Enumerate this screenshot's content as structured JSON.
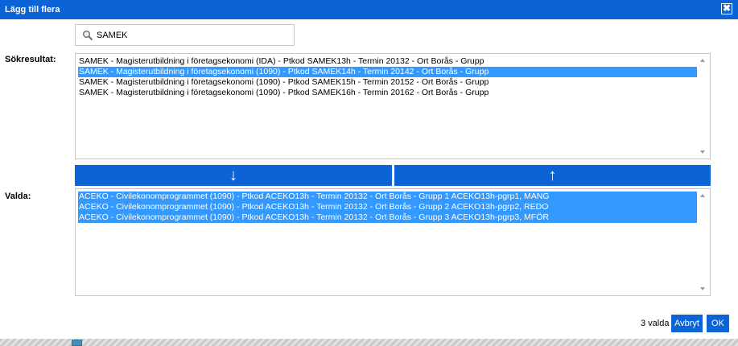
{
  "dialog": {
    "title": "Lägg till flera",
    "close_glyph": "✖"
  },
  "search": {
    "value": "SAMEK",
    "icon": "magnifier-icon"
  },
  "results": {
    "label": "Sökresultat:",
    "items": [
      {
        "text": "SAMEK - Magisterutbildning i företagsekonomi (IDA) - Ptkod SAMEK13h - Termin 20132 - Ort Borås - Grupp",
        "selected": false
      },
      {
        "text": "SAMEK - Magisterutbildning i företagsekonomi (1090) - Ptkod SAMEK14h - Termin 20142 - Ort Borås - Grupp",
        "selected": true
      },
      {
        "text": "SAMEK - Magisterutbildning i företagsekonomi (1090) - Ptkod SAMEK15h - Termin 20152 - Ort Borås - Grupp",
        "selected": false
      },
      {
        "text": "SAMEK - Magisterutbildning i företagsekonomi (1090) - Ptkod SAMEK16h - Termin 20162 - Ort Borås - Grupp",
        "selected": false
      }
    ]
  },
  "move": {
    "down_glyph": "↓",
    "up_glyph": "↑"
  },
  "selected": {
    "label": "Valda:",
    "items": [
      {
        "text": "ACEKO - Civilekonomprogrammet (1090) - Ptkod ACEKO13h - Termin 20132 - Ort Borås - Grupp 1 ACEKO13h-pgrp1, MANG",
        "selected": true
      },
      {
        "text": "ACEKO - Civilekonomprogrammet (1090) - Ptkod ACEKO13h - Termin 20132 - Ort Borås - Grupp 2 ACEKO13h-pgrp2, REDO",
        "selected": true
      },
      {
        "text": "ACEKO - Civilekonomprogrammet (1090) - Ptkod ACEKO13h - Termin 20132 - Ort Borås - Grupp 3 ACEKO13h-pgrp3, MFÖR",
        "selected": true
      }
    ]
  },
  "footer": {
    "count_text": "3 valda",
    "cancel_label": "Avbryt",
    "ok_label": "OK"
  },
  "colors": {
    "accent": "#0b63d6",
    "selection": "#3399ff"
  }
}
